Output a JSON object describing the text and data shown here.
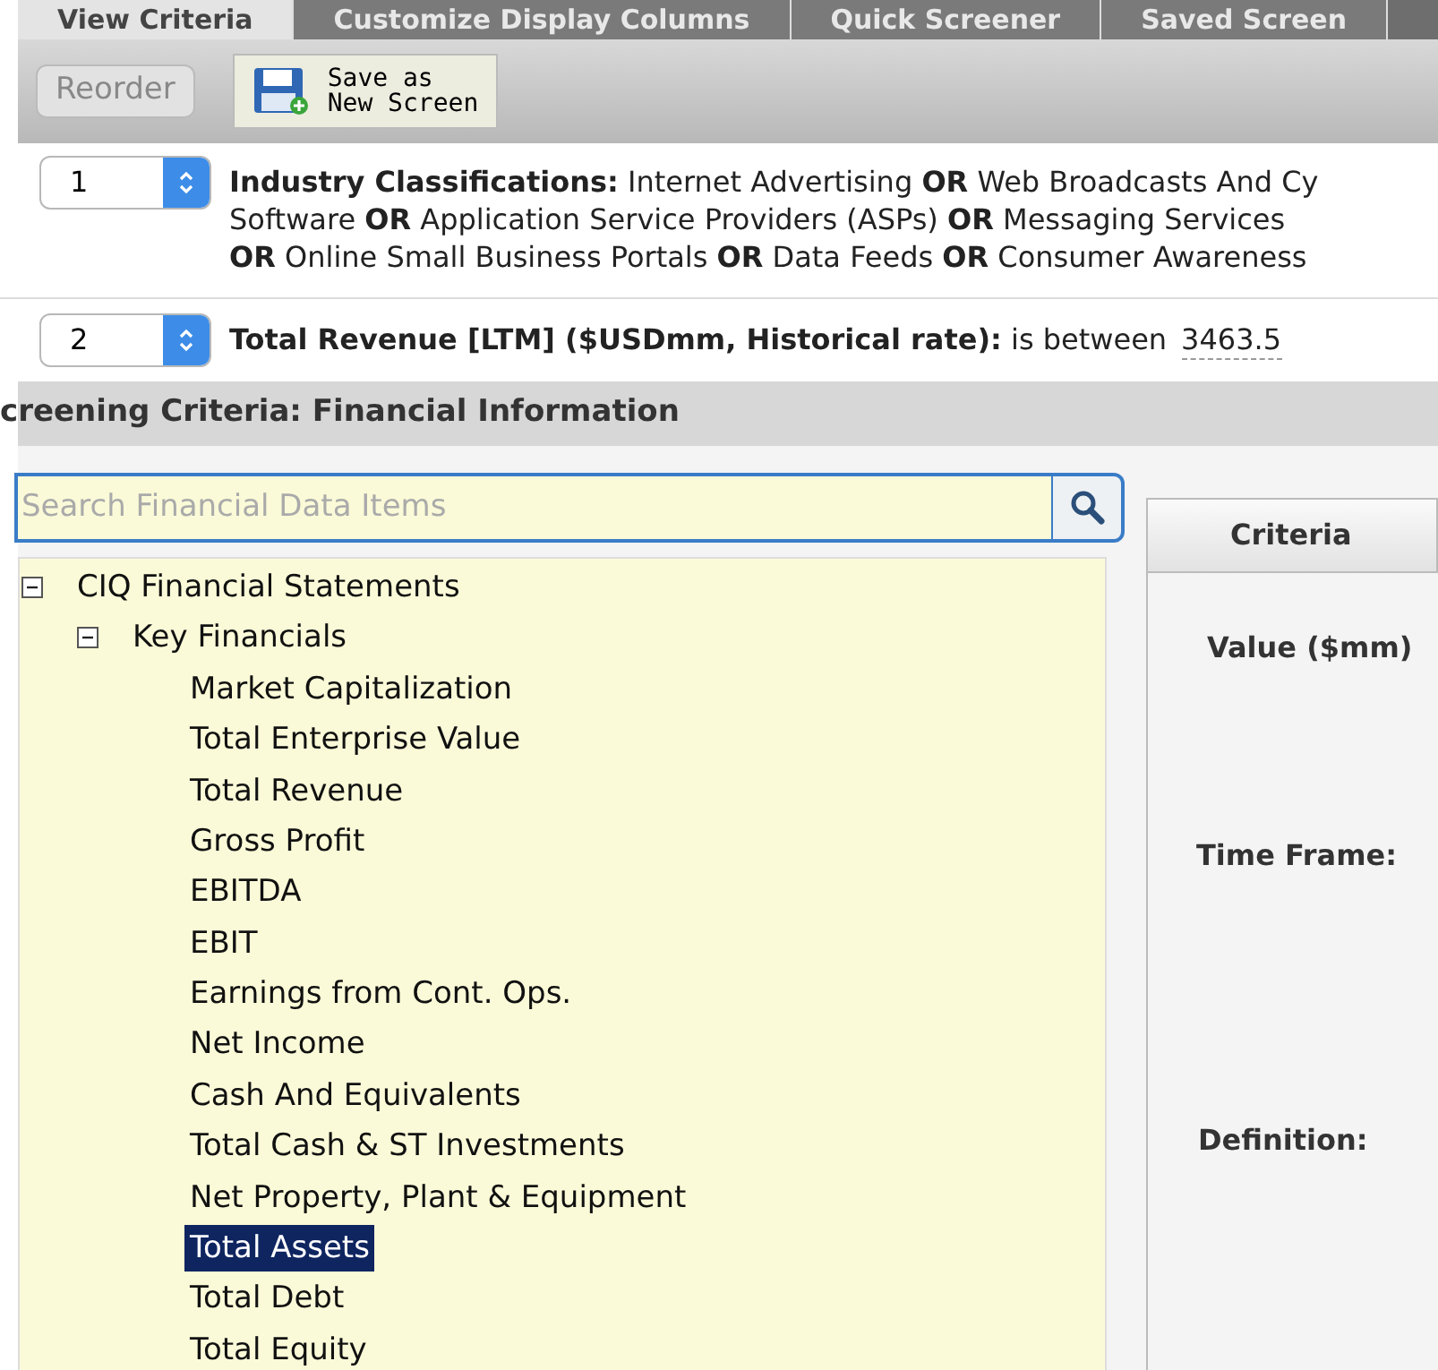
{
  "tabs": [
    {
      "label": "View Criteria",
      "selected": true
    },
    {
      "label": "Customize Display Columns",
      "selected": false
    },
    {
      "label": "Quick Screener",
      "selected": false
    },
    {
      "label": "Saved Screen",
      "selected": false
    }
  ],
  "toolbar": {
    "reorder": "Reorder",
    "save": [
      "Save as",
      "New Screen"
    ]
  },
  "criteria": [
    {
      "number": "1",
      "lines": [
        "**Industry Classifications:** Internet Advertising **OR** Web Broadcasts And Cy",
        "Software **OR** Application Service Providers (ASPs) **OR** Messaging Services",
        "**OR** Online Small Business Portals **OR** Data Feeds **OR** Consumer Awareness"
      ]
    },
    {
      "number": "2",
      "lines": [
        "**Total Revenue [LTM] ($USDmm, Historical rate):** is between"
      ],
      "value": "3463.5"
    }
  ],
  "section_title": "creening Criteria: Financial Information",
  "search": {
    "placeholder": "Search Financial Data Items"
  },
  "tree": [
    {
      "label": "CIQ Financial Statements",
      "expanded": true,
      "children": [
        {
          "label": "Key Financials",
          "expanded": true,
          "children": [
            {
              "label": "Market Capitalization",
              "selected": false
            },
            {
              "label": "Total Enterprise Value",
              "selected": false
            },
            {
              "label": "Total Revenue",
              "selected": false
            },
            {
              "label": "Gross Profit",
              "selected": false
            },
            {
              "label": "EBITDA",
              "selected": false
            },
            {
              "label": "EBIT",
              "selected": false
            },
            {
              "label": "Earnings from Cont. Ops.",
              "selected": false
            },
            {
              "label": "Net Income",
              "selected": false
            },
            {
              "label": "Cash And Equivalents",
              "selected": false
            },
            {
              "label": "Total Cash & ST Investments",
              "selected": false
            },
            {
              "label": "Net Property, Plant & Equipment",
              "selected": false
            },
            {
              "label": "Total Assets",
              "selected": true
            },
            {
              "label": "Total Debt",
              "selected": false
            },
            {
              "label": "Total Equity",
              "selected": false
            }
          ]
        }
      ]
    }
  ],
  "panel": {
    "tab": "Criteria",
    "labels": [
      "Value ($mm)",
      "Time Frame:",
      "Definition:"
    ]
  }
}
